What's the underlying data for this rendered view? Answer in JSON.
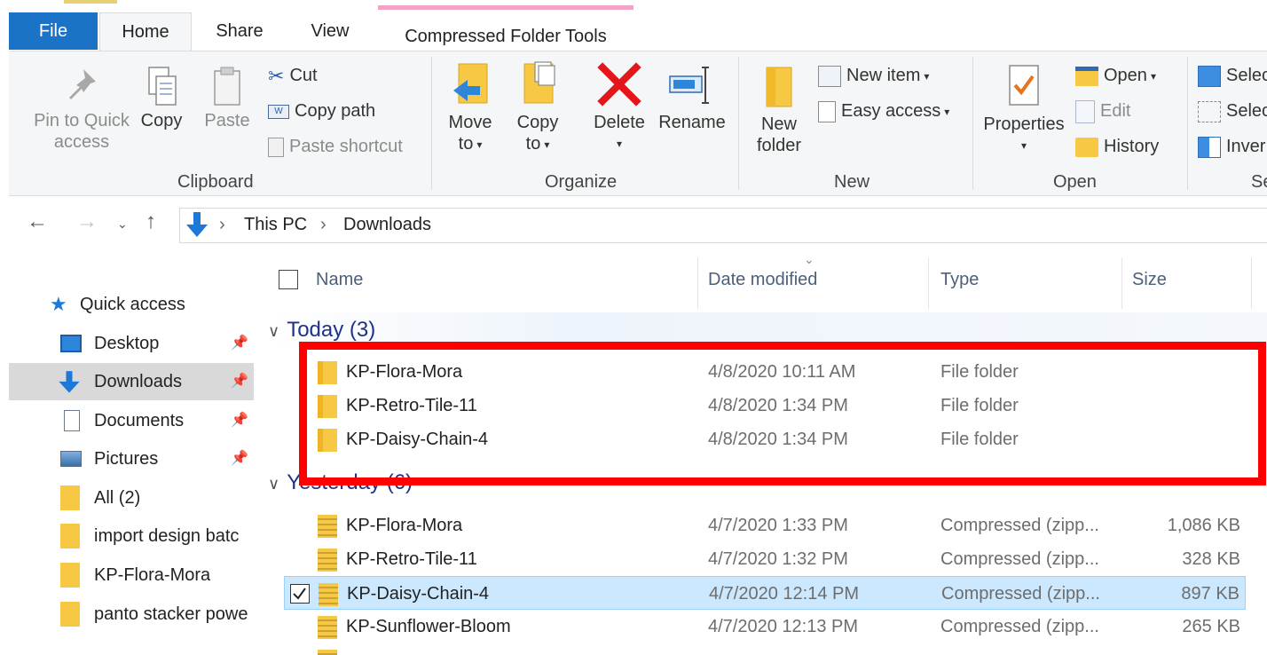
{
  "tabs": {
    "file": "File",
    "home": "Home",
    "share": "Share",
    "view": "View",
    "context": "Compressed Folder Tools"
  },
  "ribbon": {
    "clipboard": {
      "label": "Clipboard",
      "pin_line1": "Pin to Quick",
      "pin_line2": "access",
      "copy": "Copy",
      "paste": "Paste",
      "cut": "Cut",
      "copy_path": "Copy path",
      "paste_shortcut": "Paste shortcut"
    },
    "organize": {
      "label": "Organize",
      "move_line1": "Move",
      "move_line2": "to",
      "copy_line1": "Copy",
      "copy_line2": "to",
      "delete": "Delete",
      "rename": "Rename"
    },
    "new": {
      "label": "New",
      "new_folder_line1": "New",
      "new_folder_line2": "folder",
      "new_item": "New item",
      "easy_access": "Easy access"
    },
    "open": {
      "label": "Open",
      "properties": "Properties",
      "open": "Open",
      "edit": "Edit",
      "history": "History"
    },
    "select": {
      "label": "Se",
      "select_all": "Selec",
      "select_none": "Selec",
      "invert": "Inver"
    }
  },
  "address": {
    "crumbs": [
      "This PC",
      "Downloads"
    ]
  },
  "nav_pane": {
    "items": [
      {
        "label": "Quick access",
        "icon": "star-icon"
      },
      {
        "label": "Desktop",
        "icon": "desktop-icon",
        "pinned": true
      },
      {
        "label": "Downloads",
        "icon": "download-icon",
        "pinned": true,
        "selected": true
      },
      {
        "label": "Documents",
        "icon": "document-icon",
        "pinned": true
      },
      {
        "label": "Pictures",
        "icon": "picture-icon",
        "pinned": true
      },
      {
        "label": "All (2)",
        "icon": "folder-icon"
      },
      {
        "label": "import design batc",
        "icon": "folder-icon"
      },
      {
        "label": "KP-Flora-Mora",
        "icon": "folder-icon"
      },
      {
        "label": "panto stacker powe",
        "icon": "folder-icon"
      }
    ]
  },
  "columns": {
    "name": "Name",
    "date": "Date modified",
    "type": "Type",
    "size": "Size"
  },
  "groups": {
    "today": "Today (3)",
    "yesterday": "Yesterday (6)"
  },
  "today_rows": [
    {
      "name": "KP-Flora-Mora",
      "date": "4/8/2020 10:11 AM",
      "type": "File folder",
      "size": ""
    },
    {
      "name": "KP-Retro-Tile-11",
      "date": "4/8/2020 1:34 PM",
      "type": "File folder",
      "size": ""
    },
    {
      "name": "KP-Daisy-Chain-4",
      "date": "4/8/2020 1:34 PM",
      "type": "File folder",
      "size": ""
    }
  ],
  "yesterday_rows": [
    {
      "name": "KP-Flora-Mora",
      "date": "4/7/2020 1:33 PM",
      "type": "Compressed (zipp...",
      "size": "1,086 KB"
    },
    {
      "name": "KP-Retro-Tile-11",
      "date": "4/7/2020 1:32 PM",
      "type": "Compressed (zipp...",
      "size": "328 KB"
    },
    {
      "name": "KP-Daisy-Chain-4",
      "date": "4/7/2020 12:14 PM",
      "type": "Compressed (zipp...",
      "size": "897 KB",
      "selected": true
    },
    {
      "name": "KP-Sunflower-Bloom",
      "date": "4/7/2020 12:13 PM",
      "type": "Compressed (zipp...",
      "size": "265 KB"
    }
  ],
  "colors": {
    "file_tab": "#1a73c6",
    "selection": "#cce8ff",
    "highlight_box": "#ff0000",
    "group_header": "#1e3287"
  }
}
